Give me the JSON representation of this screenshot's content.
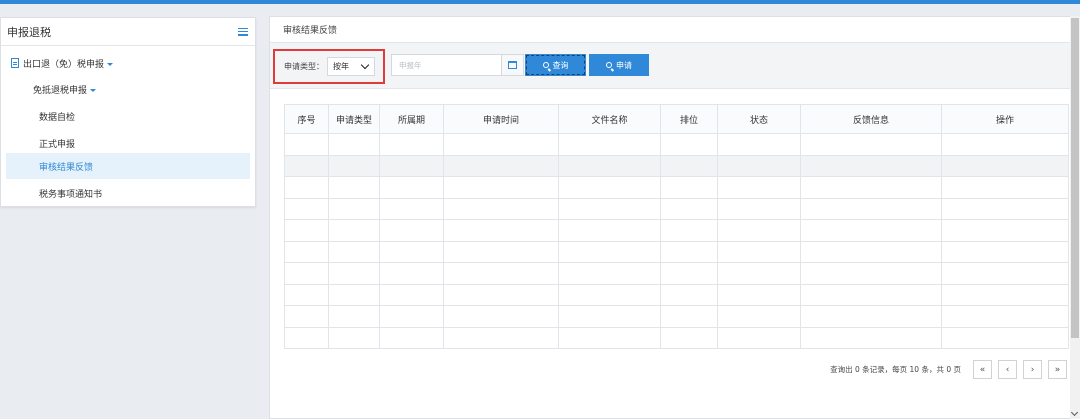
{
  "sidebar": {
    "title": "申报退税",
    "items": [
      {
        "label": "出口退（免）税申报"
      },
      {
        "label": "免抵退税申报"
      },
      {
        "label": "数据自检"
      },
      {
        "label": "正式申报"
      },
      {
        "label": "审核结果反馈"
      },
      {
        "label": "税务事项通知书"
      }
    ]
  },
  "main": {
    "breadcrumb": "审核结果反馈",
    "filter": {
      "type_label": "申请类型：",
      "type_value": "按年",
      "date_placeholder": "申报年",
      "query_label": "查询",
      "apply_label": "申请"
    },
    "table": {
      "columns": [
        "序号",
        "申请类型",
        "所属期",
        "申请时间",
        "文件名称",
        "排位",
        "状态",
        "反馈信息",
        "操作"
      ],
      "rows": []
    },
    "pager": {
      "summary": "查询出 0 条记录，每页 10 条，共 0 页",
      "first": "«",
      "prev": "‹",
      "next": "›",
      "last": "»"
    }
  },
  "colors": {
    "accent": "#2f89d8",
    "highlight_border": "#e03b3b",
    "active_bg": "#e5f1fb"
  }
}
